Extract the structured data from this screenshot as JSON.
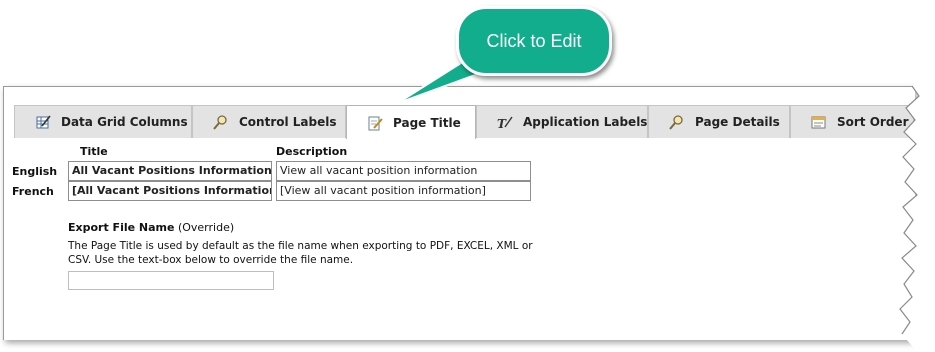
{
  "callout": {
    "text": "Click to Edit",
    "color": "#12ad8c"
  },
  "tabs": [
    {
      "label": "Data Grid Columns",
      "icon": "edit-grid-icon",
      "active": false
    },
    {
      "label": "Control Labels",
      "icon": "magnifier-icon",
      "active": false
    },
    {
      "label": "Page Title",
      "icon": "edit-page-icon",
      "active": true
    },
    {
      "label": "Application Labels",
      "icon": "text-pen-icon",
      "active": false
    },
    {
      "label": "Page Details",
      "icon": "magnifier-icon",
      "active": false
    },
    {
      "label": "Sort Order",
      "icon": "sort-order-icon",
      "active": false
    }
  ],
  "form": {
    "title_header": "Title",
    "description_header": "Description",
    "rows": [
      {
        "language": "English",
        "title": "All Vacant Positions Information",
        "description": "View all vacant position information"
      },
      {
        "language": "French",
        "title": "[All Vacant Positions Information]",
        "description": "[View all vacant position information]"
      }
    ],
    "export": {
      "heading": "Export File Name",
      "heading_suffix": " (Override)",
      "description": "The Page Title is used by default as the file name when exporting to PDF, EXCEL, XML or CSV. Use the text-box below to override the file name.",
      "value": ""
    }
  }
}
